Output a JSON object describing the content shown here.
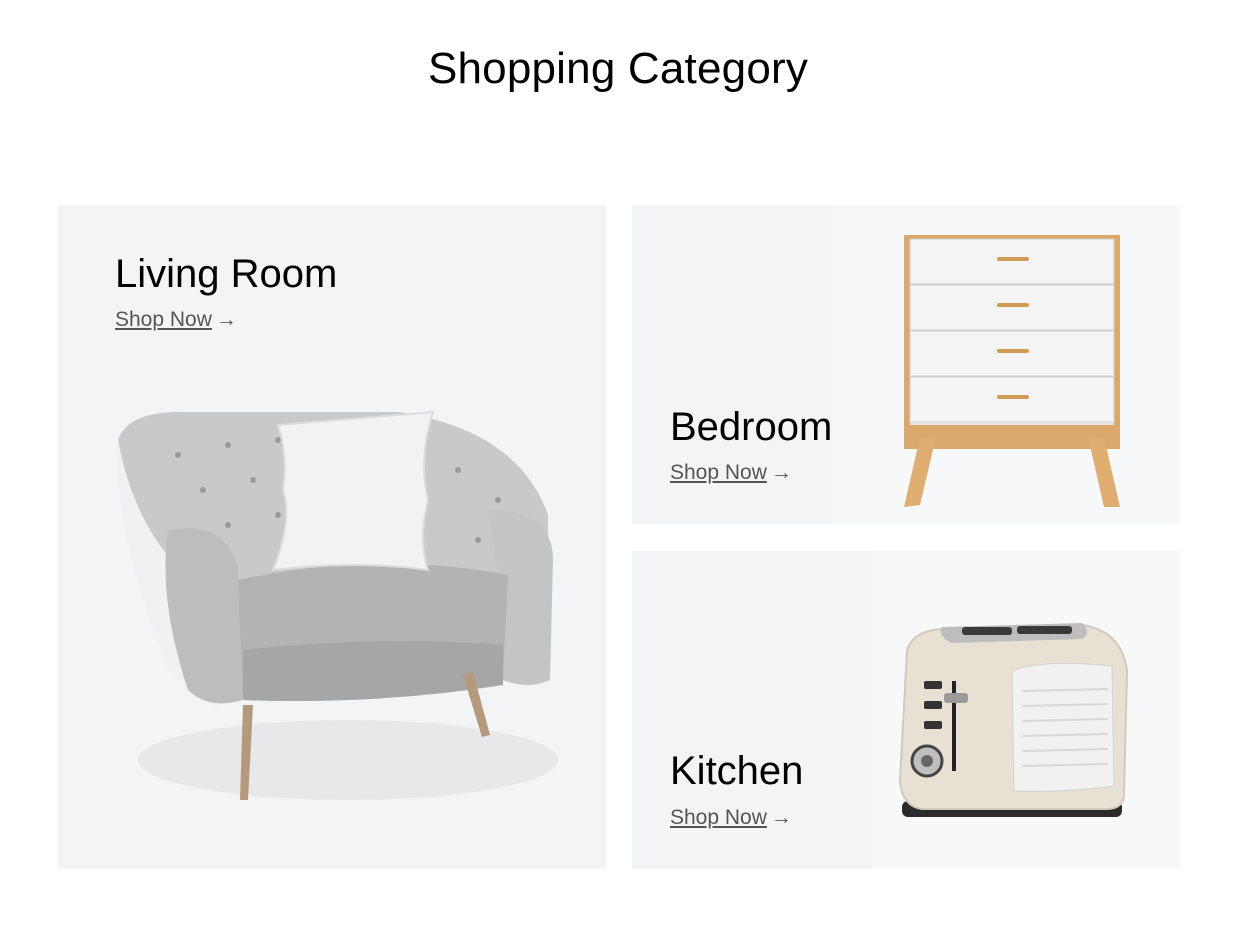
{
  "page": {
    "title": "Shopping Category"
  },
  "categories": [
    {
      "title": "Living Room",
      "link_label": "Shop Now",
      "arrow": "→",
      "image": "armchair"
    },
    {
      "title": "Bedroom",
      "link_label": "Shop Now",
      "arrow": "→",
      "image": "dresser"
    },
    {
      "title": "Kitchen",
      "link_label": "Shop Now",
      "arrow": "→",
      "image": "toaster"
    }
  ],
  "colors": {
    "card_bg": "#f2f4f6",
    "link": "#555555",
    "text": "#000000"
  }
}
